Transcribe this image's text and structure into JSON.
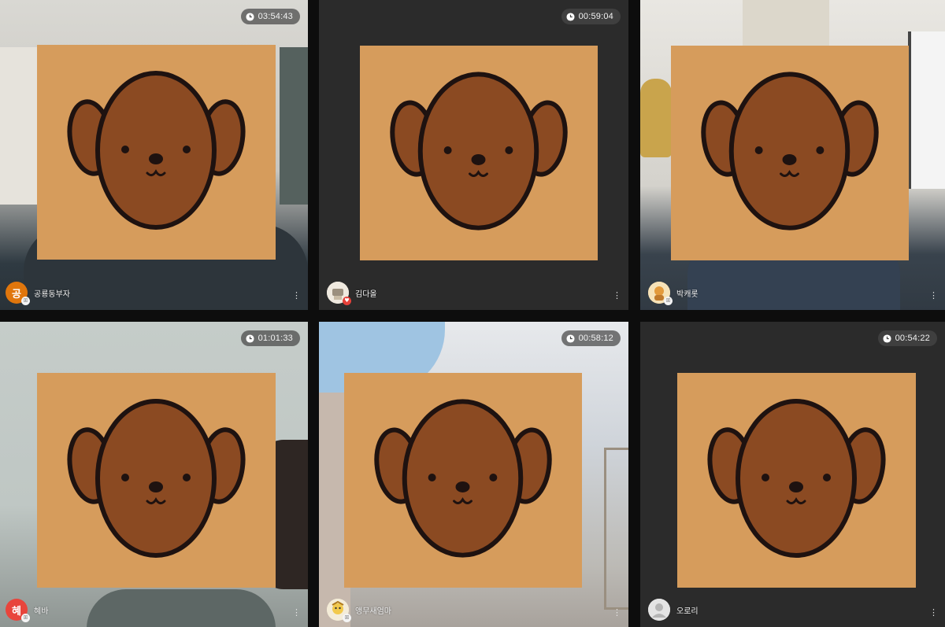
{
  "participants": [
    {
      "name": "공룡동부자",
      "timer": "03:54:43",
      "avatar_initial": "공",
      "avatar_color": "#e0760c",
      "avatar_badge": "ﾟ"
    },
    {
      "name": "김다올",
      "timer": "00:59:04",
      "avatar_initial": "",
      "avatar_color": "#efe9df",
      "avatar_badge": ""
    },
    {
      "name": "박캐롯",
      "timer": "",
      "avatar_initial": "",
      "avatar_color": "#f0c27a",
      "avatar_badge": ""
    },
    {
      "name": "혜바",
      "timer": "01:01:33",
      "avatar_initial": "혜",
      "avatar_color": "#e8453c",
      "avatar_badge": ""
    },
    {
      "name": "앵무새엄마",
      "timer": "00:58:12",
      "avatar_initial": "",
      "avatar_color": "#f1e7cf",
      "avatar_badge": ""
    },
    {
      "name": "오로리",
      "timer": "00:54:22",
      "avatar_initial": "",
      "avatar_color": "#d8d8d8",
      "avatar_badge": ""
    }
  ],
  "icons": {
    "timer": "clock-icon",
    "menu": "more-vertical-icon"
  },
  "colors": {
    "bear_card": "#d69c5c",
    "bear_face": "#8b4a22",
    "outline": "#1e1210",
    "timer_bg": "#464646"
  }
}
